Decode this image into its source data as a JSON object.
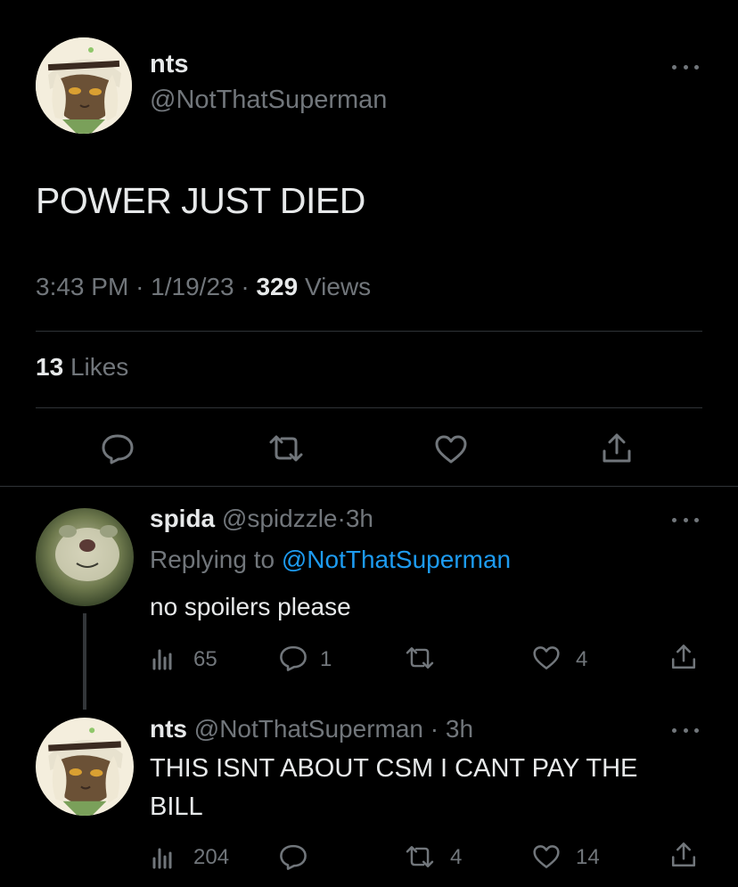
{
  "main_tweet": {
    "author_name": "nts",
    "author_handle": "@NotThatSuperman",
    "text": "POWER JUST DIED",
    "time": "3:43 PM",
    "date": "1/19/23",
    "views_count": "329",
    "views_label": "Views",
    "likes_count": "13",
    "likes_label": "Likes",
    "separator": "·"
  },
  "replies": [
    {
      "author_name": "spida",
      "author_handle": "@spidzzle",
      "age": "3h",
      "replying_prefix": "Replying to",
      "replying_to": "@NotThatSuperman",
      "text": "no spoilers please",
      "views": "65",
      "comments": "1",
      "retweets": "",
      "likes": "4"
    },
    {
      "author_name": "nts",
      "author_handle": "@NotThatSuperman",
      "age": "3h",
      "text_line1": "THIS ISNT ABOUT CSM I CANT PAY THE",
      "text_line2": "BILL",
      "views": "204",
      "comments": "",
      "retweets": "4",
      "likes": "14"
    }
  ],
  "colors": {
    "background": "#000000",
    "text": "#e7e9ea",
    "muted": "#71767b",
    "link": "#1d9bf0",
    "divider": "#2f3336"
  },
  "icons": [
    "more-icon",
    "reply-icon",
    "retweet-icon",
    "like-icon",
    "share-icon",
    "views-icon"
  ]
}
